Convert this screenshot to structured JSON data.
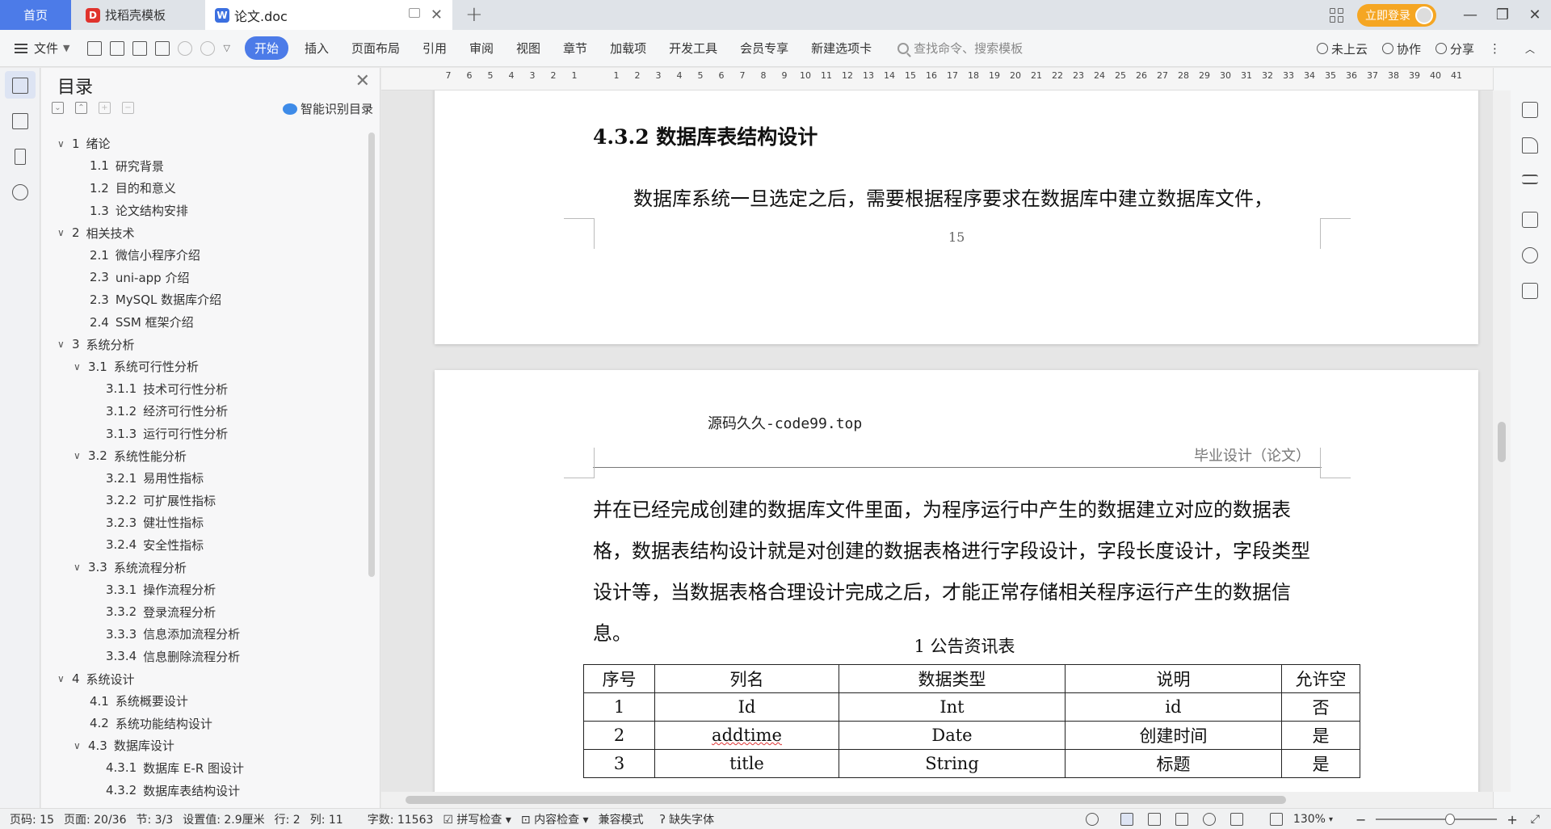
{
  "titlebar": {
    "tabs": [
      {
        "label": "首页"
      },
      {
        "label": "找稻壳模板"
      },
      {
        "label": "论文.doc"
      }
    ],
    "login_label": "立即登录"
  },
  "menubar": {
    "file_label": "文件",
    "items": [
      "开始",
      "插入",
      "页面布局",
      "引用",
      "审阅",
      "视图",
      "章节",
      "加载项",
      "开发工具",
      "会员专享",
      "新建选项卡"
    ],
    "search_placeholder": "查找命令、搜索模板",
    "cloud_label": "未上云",
    "collab_label": "协作",
    "share_label": "分享"
  },
  "toc": {
    "title": "目录",
    "smart_label": "智能识别目录",
    "items": [
      {
        "num": "1",
        "text": "绪论",
        "level": 1,
        "expanded": true
      },
      {
        "num": "1.1",
        "text": "研究背景",
        "level": 2
      },
      {
        "num": "1.2",
        "text": "目的和意义",
        "level": 2
      },
      {
        "num": "1.3",
        "text": "论文结构安排",
        "level": 2
      },
      {
        "num": "2",
        "text": "相关技术",
        "level": 1,
        "expanded": true
      },
      {
        "num": "2.1",
        "text": "微信小程序介绍",
        "level": 2
      },
      {
        "num": "2.3",
        "text": "uni-app 介绍",
        "level": 2
      },
      {
        "num": "2.3",
        "text": "MySQL 数据库介绍",
        "level": 2
      },
      {
        "num": "2.4",
        "text": "SSM 框架介绍",
        "level": 2
      },
      {
        "num": "3",
        "text": "系统分析",
        "level": 1,
        "expanded": true
      },
      {
        "num": "3.1",
        "text": "系统可行性分析",
        "level": 2,
        "expanded": true
      },
      {
        "num": "3.1.1",
        "text": "技术可行性分析",
        "level": 3
      },
      {
        "num": "3.1.2",
        "text": "经济可行性分析",
        "level": 3
      },
      {
        "num": "3.1.3",
        "text": "运行可行性分析",
        "level": 3
      },
      {
        "num": "3.2",
        "text": "系统性能分析",
        "level": 2,
        "expanded": true
      },
      {
        "num": "3.2.1",
        "text": "易用性指标",
        "level": 3
      },
      {
        "num": "3.2.2",
        "text": "可扩展性指标",
        "level": 3
      },
      {
        "num": "3.2.3",
        "text": "健壮性指标",
        "level": 3
      },
      {
        "num": "3.2.4",
        "text": "安全性指标",
        "level": 3
      },
      {
        "num": "3.3",
        "text": "系统流程分析",
        "level": 2,
        "expanded": true
      },
      {
        "num": "3.3.1",
        "text": "操作流程分析",
        "level": 3
      },
      {
        "num": "3.3.2",
        "text": "登录流程分析",
        "level": 3
      },
      {
        "num": "3.3.3",
        "text": "信息添加流程分析",
        "level": 3
      },
      {
        "num": "3.3.4",
        "text": "信息删除流程分析",
        "level": 3
      },
      {
        "num": "4",
        "text": "系统设计",
        "level": 1,
        "expanded": true
      },
      {
        "num": "4.1",
        "text": "系统概要设计",
        "level": 2
      },
      {
        "num": "4.2",
        "text": "系统功能结构设计",
        "level": 2
      },
      {
        "num": "4.3",
        "text": "数据库设计",
        "level": 2,
        "expanded": true
      },
      {
        "num": "4.3.1",
        "text": "数据库 E-R 图设计",
        "level": 3
      },
      {
        "num": "4.3.2",
        "text": "数据库表结构设计",
        "level": 3
      }
    ]
  },
  "ruler": {
    "ticks": [
      "7",
      "6",
      "5",
      "4",
      "3",
      "2",
      "1",
      "",
      "1",
      "2",
      "3",
      "4",
      "5",
      "6",
      "7",
      "8",
      "9",
      "10",
      "11",
      "12",
      "13",
      "14",
      "15",
      "16",
      "17",
      "18",
      "19",
      "20",
      "21",
      "22",
      "23",
      "24",
      "25",
      "26",
      "27",
      "28",
      "29",
      "30",
      "31",
      "32",
      "33",
      "34",
      "35",
      "36",
      "37",
      "38",
      "39",
      "40",
      "41"
    ]
  },
  "document": {
    "page1": {
      "heading": "4.3.2  数据库表结构设计",
      "paragraph": "数据库系统一旦选定之后，需要根据程序要求在数据库中建立数据库文件，",
      "page_number": "15"
    },
    "page2": {
      "header_source": "源码久久-code99.top",
      "header_right": "毕业设计（论文）",
      "body": "并在已经完成创建的数据库文件里面，为程序运行中产生的数据建立对应的数据表格，数据表结构设计就是对创建的数据表格进行字段设计，字段长度设计，字段类型设计等，当数据表格合理设计完成之后，才能正常存储相关程序运行产生的数据信息。",
      "table_caption": "1 公告资讯表",
      "table_headers": [
        "序号",
        "列名",
        "数据类型",
        "说明",
        "允许空"
      ],
      "table_rows": [
        [
          "1",
          "Id",
          "Int",
          "id",
          "否"
        ],
        [
          "2",
          "addtime",
          "Date",
          "创建时间",
          "是"
        ],
        [
          "3",
          "title",
          "String",
          "标题",
          "是"
        ]
      ]
    }
  },
  "statusbar": {
    "page_code": "页码: 15",
    "page": "页面: 20/36",
    "section": "节: 3/3",
    "setting": "设置值: 2.9厘米",
    "line": "行: 2",
    "column": "列: 11",
    "word_count": "字数: 11563",
    "spell_check": "拼写检查",
    "content_check": "内容检查",
    "compat_mode": "兼容模式",
    "missing_fonts": "缺失字体",
    "zoom": "130%"
  },
  "colors": {
    "accent": "#4c7be8",
    "login": "#f5a623"
  }
}
